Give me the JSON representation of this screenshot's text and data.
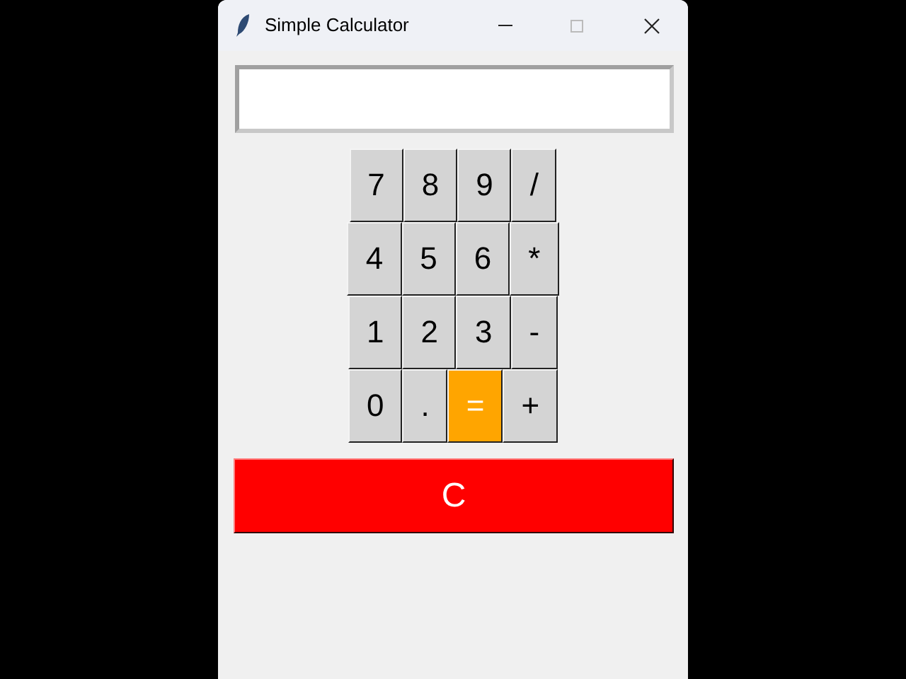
{
  "window": {
    "title": "Simple Calculator"
  },
  "keypad": [
    [
      {
        "label": "7",
        "kind": "digit"
      },
      {
        "label": "8",
        "kind": "digit"
      },
      {
        "label": "9",
        "kind": "digit"
      },
      {
        "label": "/",
        "kind": "operator"
      }
    ],
    [
      {
        "label": "4",
        "kind": "digit"
      },
      {
        "label": "5",
        "kind": "digit"
      },
      {
        "label": "6",
        "kind": "digit"
      },
      {
        "label": "*",
        "kind": "operator"
      }
    ],
    [
      {
        "label": "1",
        "kind": "digit"
      },
      {
        "label": "2",
        "kind": "digit"
      },
      {
        "label": "3",
        "kind": "digit"
      },
      {
        "label": "-",
        "kind": "operator"
      }
    ],
    [
      {
        "label": "0",
        "kind": "digit"
      },
      {
        "label": ".",
        "kind": "digit"
      },
      {
        "label": "=",
        "kind": "equals"
      },
      {
        "label": "+",
        "kind": "operator"
      }
    ]
  ],
  "clear_button": {
    "label": "C"
  }
}
